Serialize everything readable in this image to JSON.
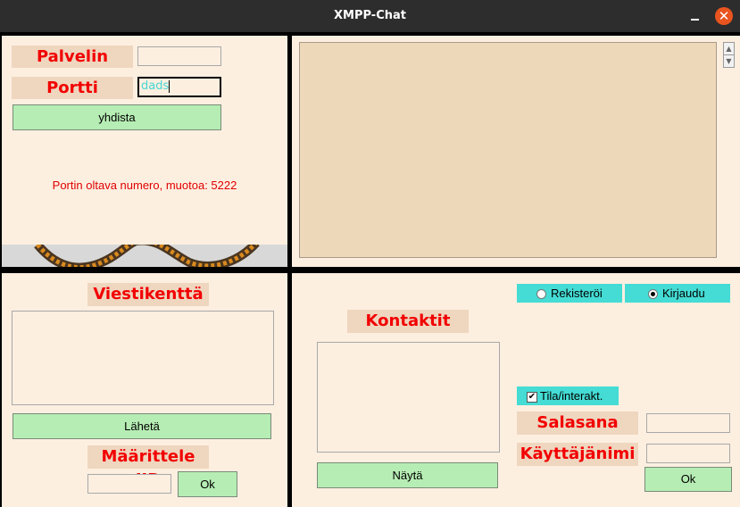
{
  "window": {
    "title": "XMPP-Chat",
    "close_glyph": "✕"
  },
  "connection": {
    "server_label": "Palvelin",
    "port_label": "Portti",
    "server_value": "",
    "port_value": "dads",
    "connect_label": "yhdista",
    "hint": "Portin oltava numero, muotoa: 5222"
  },
  "message": {
    "field_label": "Viestikenttä",
    "send_label": "Lähetä",
    "jid_label": "Määrittele JID",
    "jid_value": "",
    "ok_label": "Ok"
  },
  "contacts": {
    "label": "Kontaktit",
    "show_label": "Näytä"
  },
  "login": {
    "register_label": "Rekisteröi",
    "login_label": "Kirjaudu",
    "selected_mode": "Kirjaudu",
    "status_label": "Tila/interakt.",
    "status_checked": true,
    "check_glyph": "✔",
    "password_label": "Salasana",
    "username_label": "Käyttäjänimi",
    "ok_label": "Ok"
  },
  "icons": {
    "scroll_up": "▲",
    "scroll_down": "▼"
  },
  "colors": {
    "panel_bg": "#fdefe0",
    "label_bg": "#efd6bf",
    "label_text": "#f20000",
    "button_bg": "#b6edb4",
    "radio_bg": "#44dcd4",
    "chat_bg": "#eed8ba",
    "titlebar_bg": "#2d2d2d",
    "close_button": "#e9541f"
  }
}
